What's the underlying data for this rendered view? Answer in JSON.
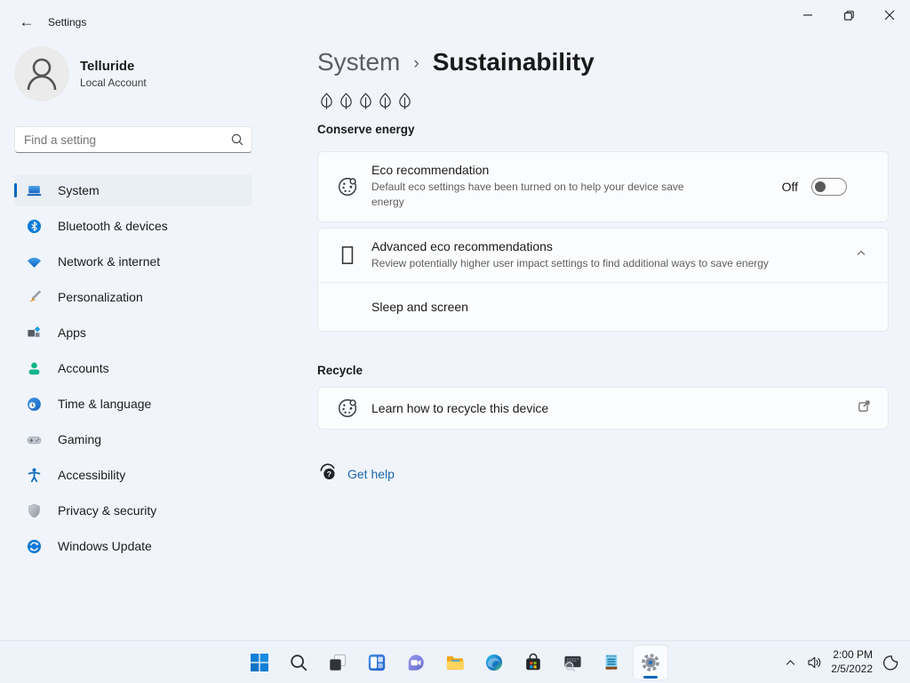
{
  "window": {
    "title": "Settings",
    "controls": {
      "minimize": "minimize",
      "restore": "restore",
      "close": "close"
    }
  },
  "account": {
    "name": "Telluride",
    "type": "Local Account"
  },
  "search": {
    "placeholder": "Find a setting"
  },
  "sidebar": {
    "items": [
      {
        "label": "System",
        "icon": "system-icon",
        "active": true
      },
      {
        "label": "Bluetooth & devices",
        "icon": "bluetooth-icon",
        "active": false
      },
      {
        "label": "Network & internet",
        "icon": "network-icon",
        "active": false
      },
      {
        "label": "Personalization",
        "icon": "personalization-icon",
        "active": false
      },
      {
        "label": "Apps",
        "icon": "apps-icon",
        "active": false
      },
      {
        "label": "Accounts",
        "icon": "accounts-icon",
        "active": false
      },
      {
        "label": "Time & language",
        "icon": "time-language-icon",
        "active": false
      },
      {
        "label": "Gaming",
        "icon": "gaming-icon",
        "active": false
      },
      {
        "label": "Accessibility",
        "icon": "accessibility-icon",
        "active": false
      },
      {
        "label": "Privacy & security",
        "icon": "privacy-security-icon",
        "active": false
      },
      {
        "label": "Windows Update",
        "icon": "windows-update-icon",
        "active": false
      }
    ]
  },
  "main": {
    "breadcrumb": {
      "parent": "System",
      "separator": "›",
      "current": "Sustainability"
    },
    "conserve_heading": "Conserve energy",
    "leaf_rating": {
      "count": 5,
      "icon": "leaf-icon"
    },
    "eco": {
      "title": "Eco recommendation",
      "description": "Default eco settings have been turned on to help your device save energy",
      "toggle_label": "Off",
      "toggle_state": "off",
      "icon": "eco-palette-icon"
    },
    "advanced": {
      "title": "Advanced eco recommendations",
      "description": "Review potentially higher user impact settings to find additional ways to save energy",
      "expanded": true,
      "icon": "placeholder-glyph-icon",
      "sub_item": "Sleep and screen"
    },
    "recycle_heading": "Recycle",
    "recycle": {
      "title": "Learn how to recycle this device",
      "icon": "eco-palette-icon",
      "action": "external-link"
    },
    "help_link": "Get help"
  },
  "taskbar": {
    "icons": [
      "start",
      "search",
      "task-view",
      "widgets",
      "chat",
      "file-explorer",
      "edge",
      "store",
      "system-search-app",
      "notepad",
      "settings"
    ],
    "running": [
      "system-search-app",
      "notepad",
      "settings"
    ],
    "active_app": "settings",
    "tray": {
      "time": "2:00 PM",
      "date": "2/5/2022",
      "icons": [
        "chevron-up",
        "volume",
        "night-light"
      ]
    }
  },
  "colors": {
    "accent": "#0067c0",
    "background": "#f1f5fb",
    "card": "#fbfcfd",
    "link": "#1d66ae",
    "text_primary": "#1b1b1b",
    "text_secondary": "#5f5f5f",
    "taskbar": "#eef3fa"
  }
}
